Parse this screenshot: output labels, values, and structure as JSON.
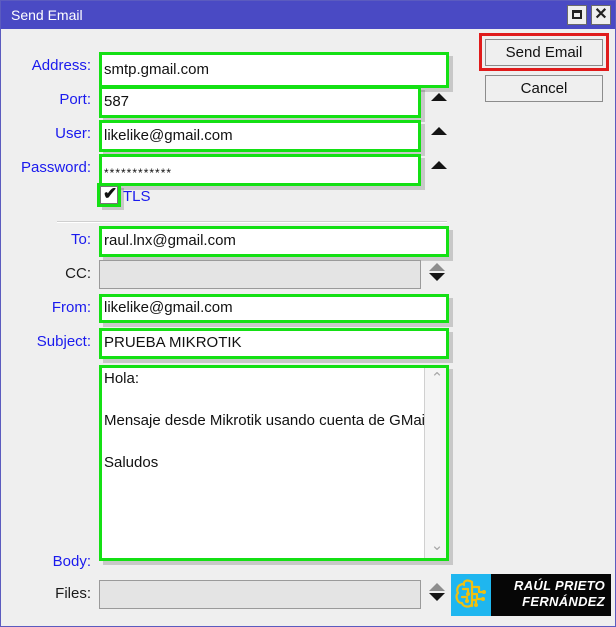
{
  "window": {
    "title": "Send Email",
    "buttons": {
      "maximize": "maximize-restore",
      "close": "✕"
    }
  },
  "actions": {
    "send": "Send Email",
    "cancel": "Cancel"
  },
  "fields": {
    "address": {
      "label": "Address:",
      "value": "smtp.gmail.com"
    },
    "port": {
      "label": "Port:",
      "value": "587"
    },
    "user": {
      "label": "User:",
      "value": "likelike@gmail.com"
    },
    "password": {
      "label": "Password:",
      "value": "************"
    },
    "tls": {
      "label": "TLS",
      "checked": true,
      "mark": "✔"
    },
    "to": {
      "label": "To:",
      "value": "raul.lnx@gmail.com"
    },
    "cc": {
      "label": "CC:",
      "value": ""
    },
    "from": {
      "label": "From:",
      "value": "likelike@gmail.com"
    },
    "subject": {
      "label": "Subject:",
      "value": "PRUEBA MIKROTIK"
    },
    "body": {
      "label": "Body:",
      "value": "Hola:\n\nMensaje desde Mikrotik usando cuenta de GMail.\n\nSaludos"
    },
    "files": {
      "label": "Files:",
      "value": ""
    }
  },
  "scrollbar": {
    "up": "⌃",
    "down": "⌄"
  },
  "logo": {
    "line1": "RAÚL PRIETO",
    "line2": "FERNÁNDEZ"
  },
  "colors": {
    "titlebar": "#4a4ac4",
    "label_link": "#1a1aee",
    "label_plain": "#1b1b1b",
    "highlight_green": "#14e014",
    "highlight_red": "#e01b1b",
    "window_bg": "#efefef",
    "logo_accent": "#1fb6ef"
  }
}
